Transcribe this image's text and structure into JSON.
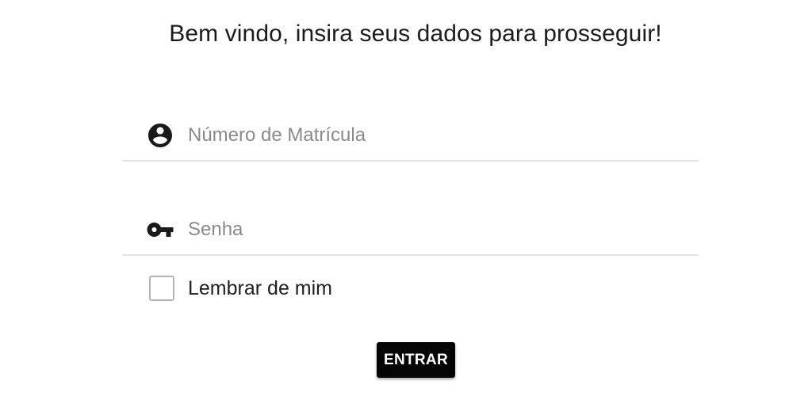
{
  "header": {
    "title": "Bem vindo, insira seus dados para prosseguir!"
  },
  "form": {
    "matricula": {
      "icon": "account-circle-icon",
      "placeholder": "Número de Matrícula",
      "value": ""
    },
    "senha": {
      "icon": "key-icon",
      "placeholder": "Senha",
      "value": ""
    },
    "remember": {
      "label": "Lembrar de mim",
      "checked": false
    },
    "submit_label": "ENTRAR"
  },
  "colors": {
    "button_bg": "#050505",
    "button_text": "#ffffff",
    "field_underline": "#e3e3e3",
    "placeholder": "#8a8a8a",
    "text": "#1c1c1c"
  }
}
